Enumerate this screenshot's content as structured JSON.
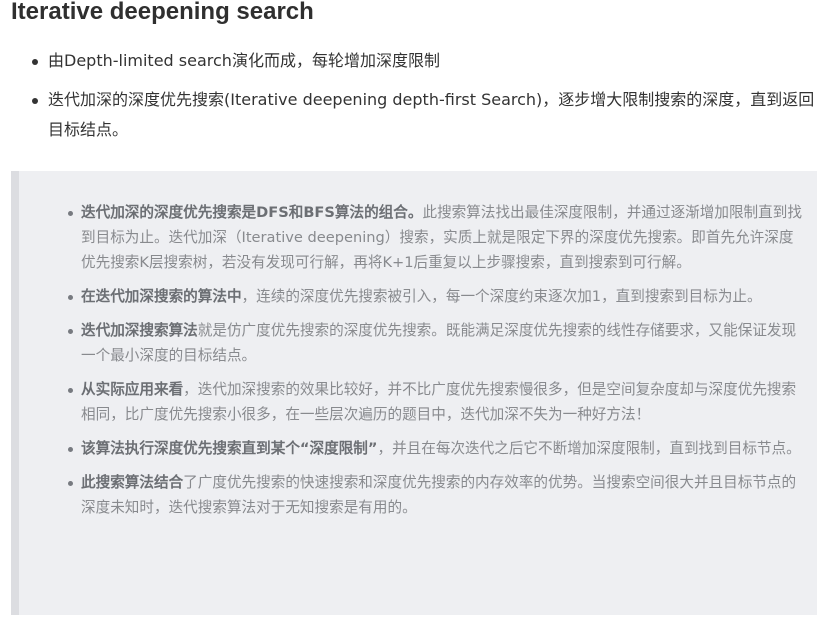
{
  "heading": "Iterative deepening search",
  "intro_items": [
    "由Depth-limited search演化而成，每轮增加深度限制",
    "迭代加深的深度优先搜索(Iterative deepening depth-first Search)，逐步增大限制搜索的深度，直到返回目标结点。"
  ],
  "quote_items": [
    {
      "bold": "迭代加深的深度优先搜索是DFS和BFS算法的组合。",
      "text": "此搜索算法找出最佳深度限制，并通过逐渐增加限制直到找到目标为止。迭代加深（Iterative deepening）搜索，实质上就是限定下界的深度优先搜索。即首先允许深度优先搜索K层搜索树，若没有发现可行解，再将K+1后重复以上步骤搜索，直到搜索到可行解。"
    },
    {
      "bold": "在迭代加深搜索的算法中",
      "text": "，连续的深度优先搜索被引入，每一个深度约束逐次加1，直到搜索到目标为止。"
    },
    {
      "bold": "迭代加深搜索算法",
      "text": "就是仿广度优先搜索的深度优先搜索。既能满足深度优先搜索的线性存储要求，又能保证发现一个最小深度的目标结点。"
    },
    {
      "bold": "从实际应用来看",
      "text": "，迭代加深搜索的效果比较好，并不比广度优先搜索慢很多，但是空间复杂度却与深度优先搜索相同，比广度优先搜索小很多，在一些层次遍历的题目中，迭代加深不失为一种好方法！"
    },
    {
      "bold": "该算法执行深度优先搜索直到某个“深度限制”",
      "text": "，并且在每次迭代之后它不断增加深度限制，直到找到目标节点。"
    },
    {
      "bold": "此搜索算法结合",
      "text": "了广度优先搜索的快速搜索和深度优先搜索的内存效率的优势。当搜索空间很大并且目标节点的深度未知时，迭代搜索算法对于无知搜索是有用的。"
    }
  ]
}
